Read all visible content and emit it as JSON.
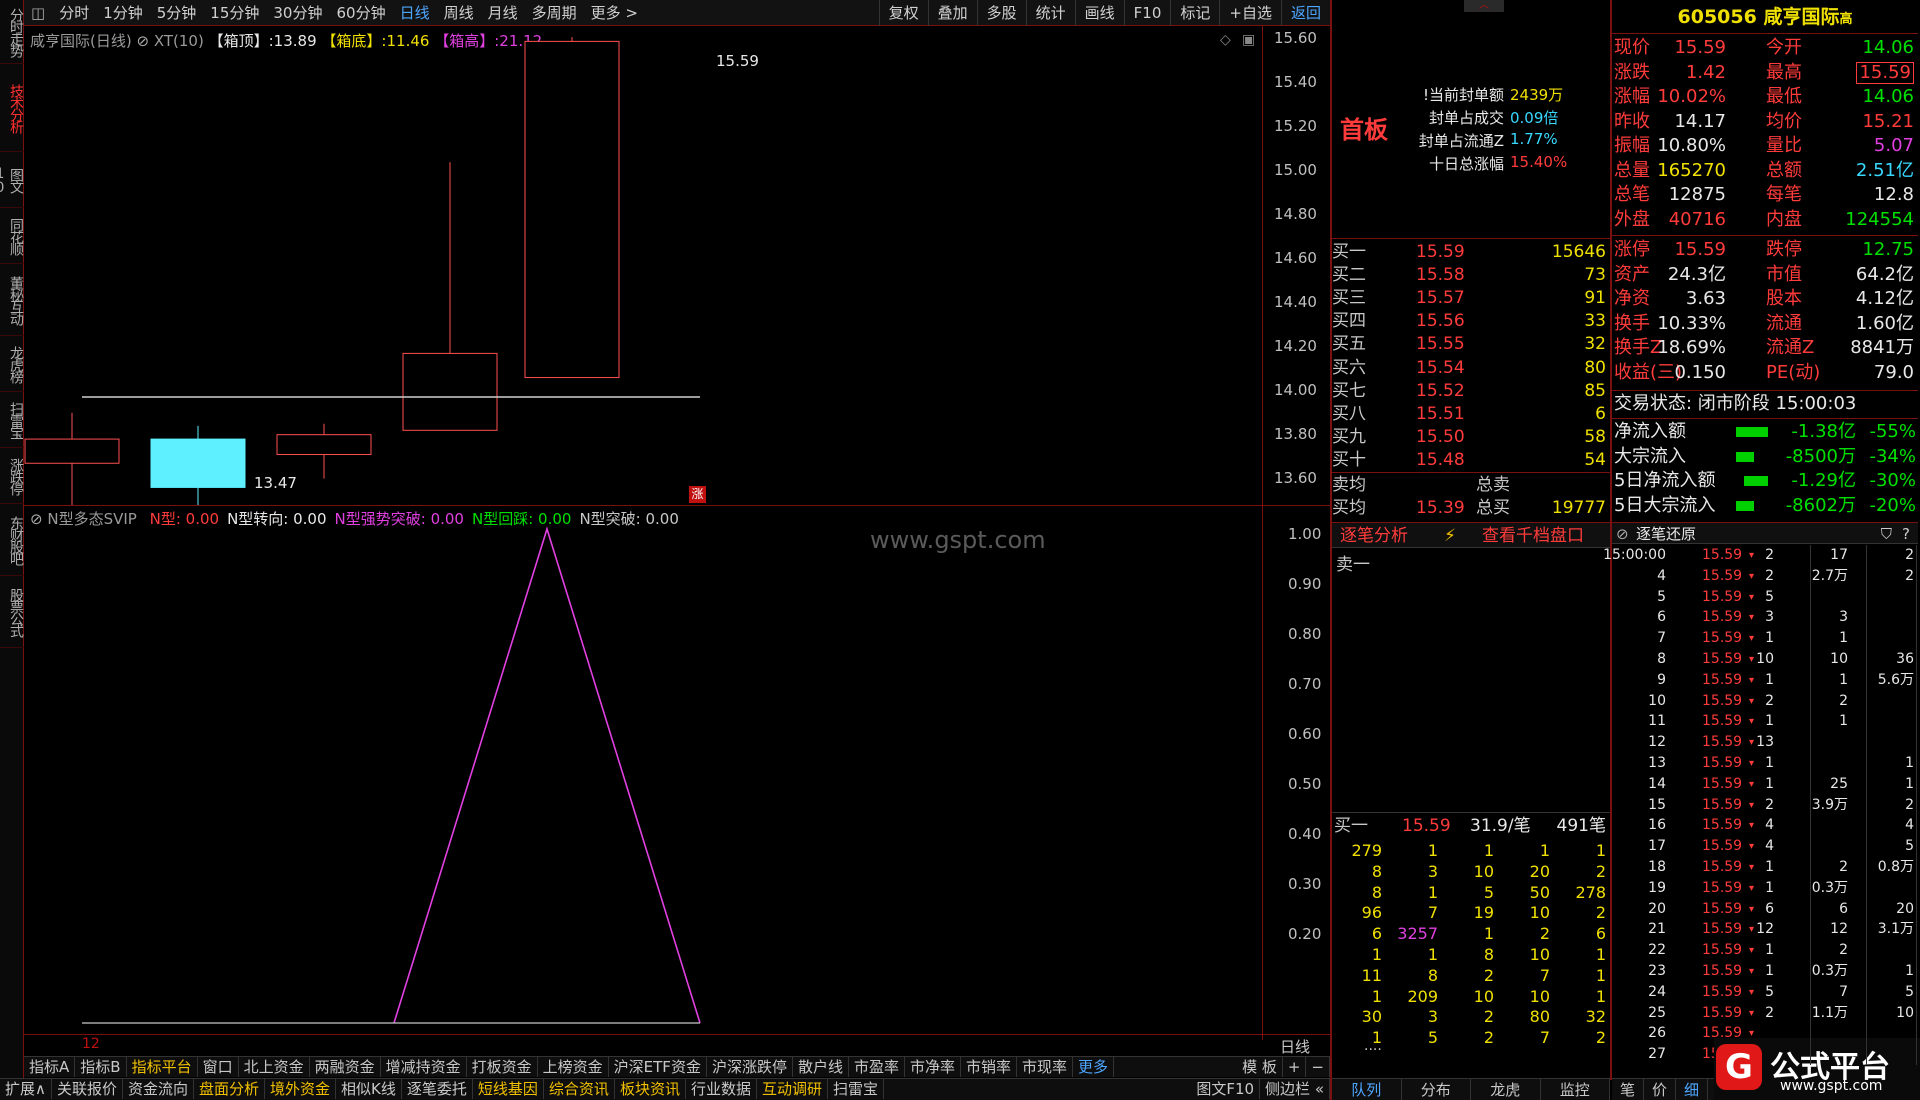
{
  "left_tabs": [
    "分时走势",
    "技术分析",
    "图文10",
    "同花顺",
    "董秘互动",
    "龙虎榜",
    "扫雷宝",
    "涨跌停",
    "东财股吧",
    "股票公式"
  ],
  "left_active": 1,
  "toolbar": {
    "left": [
      "分时",
      "1分钟",
      "5分钟",
      "15分钟",
      "30分钟",
      "60分钟",
      "日线",
      "周线",
      "月线",
      "多周期",
      "更多 >"
    ],
    "active": "日线",
    "right": [
      "复权",
      "叠加",
      "多股",
      "统计",
      "画线",
      "F10",
      "标记",
      "+自选",
      "返回"
    ],
    "right_active": "返回"
  },
  "main_info": {
    "name": "咸亨国际(日线)",
    "ind": "XT(10)",
    "box_top_label": "【箱顶】",
    "box_top": ":13.89",
    "box_bottom_label": "【箱底】",
    "box_bottom": ":11.46",
    "box_high_label": "【箱高】",
    "box_high": ":21.12"
  },
  "price_axis": [
    "15.60",
    "15.40",
    "15.20",
    "15.00",
    "14.80",
    "14.60",
    "14.40",
    "14.20",
    "14.00",
    "13.80",
    "13.60"
  ],
  "candle_labels": {
    "high": "15.59",
    "low": "13.47",
    "zhang": "涨"
  },
  "sub_info": {
    "name": "N型多态SVIP",
    "items": [
      {
        "label": "N型: 0.00",
        "color": "#ff3b3b"
      },
      {
        "label": "N型转向: 0.00",
        "color": "#e8e8e8"
      },
      {
        "label": "N型强势突破: 0.00",
        "color": "#e040e0"
      },
      {
        "label": "N型回踩: 0.00",
        "color": "#00e000"
      },
      {
        "label": "N型突破: 0.00",
        "color": "#c8c8c8"
      }
    ]
  },
  "sub_axis": [
    "1.00",
    "0.90",
    "0.80",
    "0.70",
    "0.60",
    "0.50",
    "0.40",
    "0.30",
    "0.20"
  ],
  "watermark": "www.gspt.com",
  "xaxis_label": "12",
  "period_label": "日线",
  "seal": {
    "title": "首板",
    "rows": [
      {
        "k": "!当前封单额",
        "v": "2439万",
        "c": "#f0e000"
      },
      {
        "k": "封单占成交",
        "v": "0.09倍",
        "c": "#38d8ff"
      },
      {
        "k": "封单占流通Z",
        "v": "1.77%",
        "c": "#38d8ff"
      },
      {
        "k": "十日总涨幅",
        "v": "15.40%",
        "c": "#ff3b3b"
      }
    ]
  },
  "order_book": [
    [
      "买一",
      "15.59",
      "15646"
    ],
    [
      "买二",
      "15.58",
      "73"
    ],
    [
      "买三",
      "15.57",
      "91"
    ],
    [
      "买四",
      "15.56",
      "33"
    ],
    [
      "买五",
      "15.55",
      "32"
    ],
    [
      "买六",
      "15.54",
      "80"
    ],
    [
      "买七",
      "15.52",
      "85"
    ],
    [
      "买八",
      "15.51",
      "6"
    ],
    [
      "买九",
      "15.50",
      "58"
    ],
    [
      "买十",
      "15.48",
      "54"
    ]
  ],
  "order_summary": {
    "sell_avg": "卖均",
    "total_sell": "总卖",
    "buy_avg": "买均",
    "buy_avg_v": "15.39",
    "total_buy": "总买",
    "total_buy_v": "19777"
  },
  "mid_tabs": {
    "a": "逐笔分析",
    "b": "查看千档盘口"
  },
  "sell1": "卖一",
  "queue_head": {
    "label": "买一",
    "price": "15.59",
    "per": "31.9/笔",
    "count": "491笔"
  },
  "queue": [
    [
      "279",
      "1",
      "1",
      "1",
      "1"
    ],
    [
      "8",
      "3",
      "10",
      "20",
      "2"
    ],
    [
      "8",
      "1",
      "5",
      "50",
      "278"
    ],
    [
      "96",
      "7",
      "19",
      "10",
      "2"
    ],
    [
      "6",
      "3257",
      "1",
      "2",
      "6"
    ],
    [
      "1",
      "1",
      "8",
      "10",
      "1"
    ],
    [
      "11",
      "8",
      "2",
      "7",
      "1"
    ],
    [
      "1",
      "209",
      "10",
      "10",
      "1"
    ],
    [
      "30",
      "3",
      "2",
      "80",
      "32"
    ],
    [
      "1",
      "5",
      "2",
      "7",
      "2"
    ]
  ],
  "queue_more": "....",
  "stock_header": {
    "code": "605056",
    "name": "咸亨国际",
    "tag": "高"
  },
  "quote": [
    [
      {
        "t": "现价",
        "c": "#ff3b3b"
      },
      {
        "t": "15.59",
        "c": "#ff3b3b"
      },
      {
        "t": "今开",
        "c": "#ff3b3b"
      },
      {
        "t": "14.06",
        "c": "#00e000"
      }
    ],
    [
      {
        "t": "涨跌",
        "c": "#ff3b3b"
      },
      {
        "t": "1.42",
        "c": "#ff3b3b"
      },
      {
        "t": "最高",
        "c": "#ff3b3b"
      },
      {
        "t": "15.59",
        "c": "#ff3b3b"
      }
    ],
    [
      {
        "t": "涨幅",
        "c": "#ff3b3b"
      },
      {
        "t": "10.02%",
        "c": "#ff3b3b"
      },
      {
        "t": "最低",
        "c": "#ff3b3b"
      },
      {
        "t": "14.06",
        "c": "#00e000"
      }
    ],
    [
      {
        "t": "昨收",
        "c": "#ff3b3b"
      },
      {
        "t": "14.17",
        "c": "#e8e8e8"
      },
      {
        "t": "均价",
        "c": "#ff3b3b"
      },
      {
        "t": "15.21",
        "c": "#ff3b3b"
      }
    ],
    [
      {
        "t": "振幅",
        "c": "#ff3b3b"
      },
      {
        "t": "10.80%",
        "c": "#e8e8e8"
      },
      {
        "t": "量比",
        "c": "#ff3b3b"
      },
      {
        "t": "5.07",
        "c": "#e040e0"
      }
    ],
    [
      {
        "t": "总量",
        "c": "#ff3b3b"
      },
      {
        "t": "165270",
        "c": "#f0e000"
      },
      {
        "t": "总额",
        "c": "#ff3b3b"
      },
      {
        "t": "2.51亿",
        "c": "#38d8ff"
      }
    ],
    [
      {
        "t": "总笔",
        "c": "#ff3b3b"
      },
      {
        "t": "12875",
        "c": "#e8e8e8"
      },
      {
        "t": "每笔",
        "c": "#ff3b3b"
      },
      {
        "t": "12.8",
        "c": "#e8e8e8"
      }
    ],
    [
      {
        "t": "外盘",
        "c": "#ff3b3b"
      },
      {
        "t": "40716",
        "c": "#ff3b3b"
      },
      {
        "t": "内盘",
        "c": "#ff3b3b"
      },
      {
        "t": "124554",
        "c": "#00e000"
      }
    ],
    [
      {
        "t": "涨停",
        "c": "#ff3b3b"
      },
      {
        "t": "15.59",
        "c": "#ff3b3b"
      },
      {
        "t": "跌停",
        "c": "#ff3b3b"
      },
      {
        "t": "12.75",
        "c": "#00e000"
      }
    ],
    [
      {
        "t": "资产",
        "c": "#ff3b3b"
      },
      {
        "t": "24.3亿",
        "c": "#e8e8e8"
      },
      {
        "t": "市值",
        "c": "#ff3b3b"
      },
      {
        "t": "64.2亿",
        "c": "#e8e8e8"
      }
    ],
    [
      {
        "t": "净资",
        "c": "#ff3b3b"
      },
      {
        "t": "3.63",
        "c": "#e8e8e8"
      },
      {
        "t": "股本",
        "c": "#ff3b3b"
      },
      {
        "t": "4.12亿",
        "c": "#e8e8e8"
      }
    ],
    [
      {
        "t": "换手",
        "c": "#ff3b3b"
      },
      {
        "t": "10.33%",
        "c": "#e8e8e8"
      },
      {
        "t": "流通",
        "c": "#ff3b3b"
      },
      {
        "t": "1.60亿",
        "c": "#e8e8e8"
      }
    ],
    [
      {
        "t": "换手Z",
        "c": "#ff3b3b"
      },
      {
        "t": "18.69%",
        "c": "#e8e8e8"
      },
      {
        "t": "流通Z",
        "c": "#ff3b3b"
      },
      {
        "t": "8841万",
        "c": "#e8e8e8"
      }
    ],
    [
      {
        "t": "收益(三)",
        "c": "#ff3b3b"
      },
      {
        "t": "0.150",
        "c": "#e8e8e8"
      },
      {
        "t": "PE(动)",
        "c": "#ff3b3b"
      },
      {
        "t": "79.0",
        "c": "#e8e8e8"
      }
    ]
  ],
  "trade_status": "交易状态: 闭市阶段 15:00:03",
  "flows": [
    {
      "k": "净流入额",
      "v": "-1.38亿",
      "p": "-55%"
    },
    {
      "k": "大宗流入",
      "v": "-8500万",
      "p": "-34%"
    },
    {
      "k": "5日净流入额",
      "v": "-1.29亿",
      "p": "-30%"
    },
    {
      "k": "5日大宗流入",
      "v": "-8602万",
      "p": "-20%"
    }
  ],
  "ticks_header": "逐笔还原",
  "ticks": [
    [
      "15:00:00",
      "15.59",
      "2",
      "17",
      "2"
    ],
    [
      "4",
      "15.59",
      "2",
      "2.7万",
      "2"
    ],
    [
      "5",
      "15.59",
      "5",
      "",
      ""
    ],
    [
      "6",
      "15.59",
      "3",
      "3",
      ""
    ],
    [
      "7",
      "15.59",
      "1",
      "1",
      ""
    ],
    [
      "8",
      "15.59",
      "10",
      "10",
      "36"
    ],
    [
      "9",
      "15.59",
      "1",
      "1",
      "5.6万"
    ],
    [
      "10",
      "15.59",
      "2",
      "2",
      ""
    ],
    [
      "11",
      "15.59",
      "1",
      "1",
      ""
    ],
    [
      "12",
      "15.59",
      "13",
      "",
      ""
    ],
    [
      "13",
      "15.59",
      "1",
      "",
      "1"
    ],
    [
      "14",
      "15.59",
      "1",
      "25",
      "1"
    ],
    [
      "15",
      "15.59",
      "2",
      "3.9万",
      "2"
    ],
    [
      "16",
      "15.59",
      "4",
      "",
      "4"
    ],
    [
      "17",
      "15.59",
      "4",
      "",
      "5"
    ],
    [
      "18",
      "15.59",
      "1",
      "2",
      "0.8万"
    ],
    [
      "19",
      "15.59",
      "1",
      "0.3万",
      ""
    ],
    [
      "20",
      "15.59",
      "6",
      "6",
      "20"
    ],
    [
      "21",
      "15.59",
      "12",
      "12",
      "3.1万"
    ],
    [
      "22",
      "15.59",
      "1",
      "2",
      ""
    ],
    [
      "23",
      "15.59",
      "1",
      "0.3万",
      "1"
    ],
    [
      "24",
      "15.59",
      "5",
      "7",
      "5"
    ],
    [
      "25",
      "15.59",
      "2",
      "1.1万",
      "10"
    ],
    [
      "26",
      "15.59",
      "",
      "",
      " "
    ],
    [
      "27",
      "15.59",
      "",
      "",
      ""
    ]
  ],
  "bottom_row1": [
    "指标A",
    "指标B",
    "指标平台",
    "窗口",
    "北上资金",
    "两融资金",
    "增减持资金",
    "打板资金",
    "上榜资金",
    "沪深ETF资金",
    "沪深涨跌停",
    "散户线",
    "市盈率",
    "市净率",
    "市销率",
    "市现率",
    "更多"
  ],
  "bottom_row1_right": [
    "模 板",
    "+",
    "−"
  ],
  "bottom_row2": [
    "扩展∧",
    "关联报价",
    "资金流向",
    "盘面分析",
    "境外资金",
    "相似K线",
    "逐笔委托",
    "短线基因",
    "综合资讯",
    "板块资讯",
    "行业数据",
    "互动调研",
    "扫雷宝"
  ],
  "bottom_row2_right": [
    "图文F10",
    "侧边栏 «"
  ],
  "bottom_tabs_mid": [
    "队列",
    "分布",
    "龙虎",
    "监控"
  ],
  "bottom_tabs_right": [
    "笔",
    "价",
    "细"
  ],
  "logo": {
    "text": "公式平台",
    "url": "www.gspt.com"
  },
  "colors": {
    "up": "#ff3b3b",
    "down": "#00e000",
    "panel_border": "#7a1010",
    "cyan_candle": "#5ef0ff"
  }
}
